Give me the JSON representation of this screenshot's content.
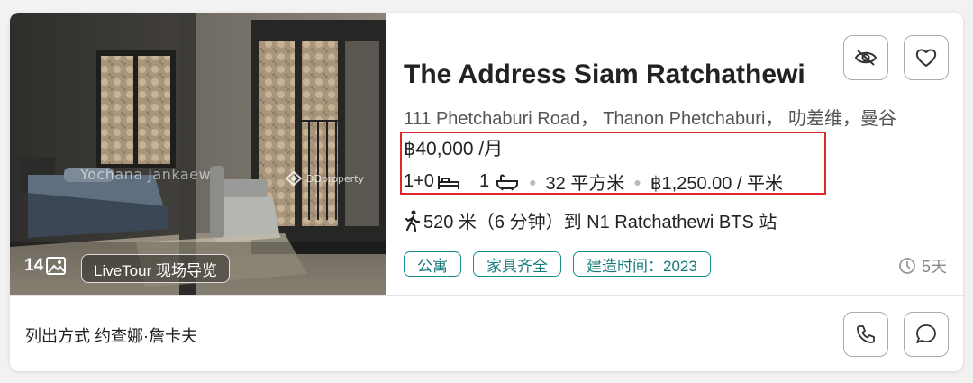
{
  "listing": {
    "title": "The Address Siam Ratchathewi",
    "address": "111 Phetchaburi Road， Thanon Phetchaburi， 叻差维，曼谷",
    "price": "฿40,000 /月",
    "beds": "1+0",
    "baths": "1",
    "area": "32 平方米",
    "price_per_sqm": "฿1,250.00 / 平米",
    "transit": "520 米（6 分钟）到 N1 Ratchathewi BTS 站",
    "tags": [
      "公寓",
      "家具齐全",
      "建造时间：2023"
    ],
    "posted": "5天"
  },
  "photo": {
    "count": "14",
    "livetour_label": "LiveTour 现场导览",
    "watermark_name": "Yochana Jankaew",
    "watermark_logo": "DDproperty"
  },
  "footer": {
    "lister_label": "列出方式",
    "lister_name": "约查娜·詹卡夫"
  },
  "colors": {
    "accent_teal": "#1a8f8f",
    "highlight_red": "#e0262b"
  },
  "icons": {
    "hide": "eye-slash-icon",
    "favorite": "heart-icon",
    "call": "phone-icon",
    "chat": "chat-bubble-icon",
    "photos": "image-icon",
    "walk": "walking-person-icon",
    "bed": "bed-icon",
    "bath": "bathtub-icon",
    "time": "clock-icon"
  }
}
